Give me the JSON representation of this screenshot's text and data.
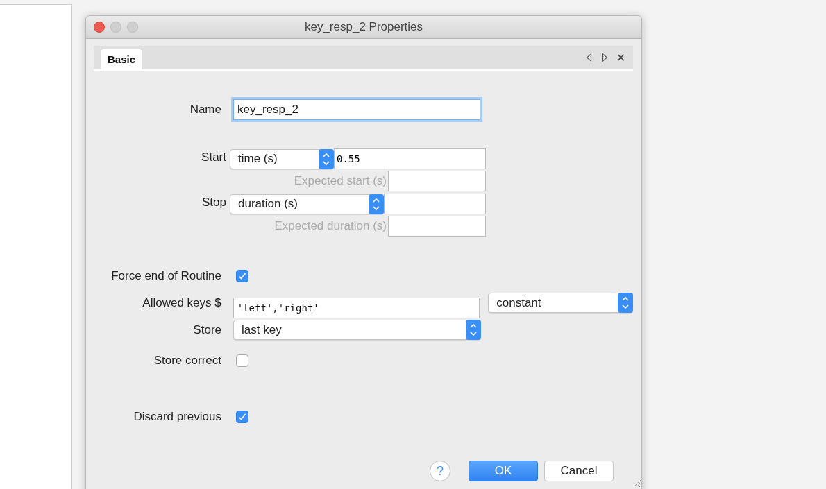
{
  "window": {
    "title": "key_resp_2 Properties"
  },
  "tabs": [
    {
      "label": "Basic",
      "selected": true
    }
  ],
  "fields": [
    {
      "kind": "text",
      "label": "Name",
      "value": "key_resp_2",
      "focused": true
    },
    {
      "kind": "timing",
      "label": "Start",
      "select": "time (s)",
      "value": "0.55",
      "expected_label": "Expected start (s)"
    },
    {
      "kind": "timing",
      "label": "Stop",
      "select": "duration (s)",
      "expected_label": "Expected duration (s)"
    },
    {
      "kind": "checkbox",
      "label": "Force end of Routine",
      "checked": true
    },
    {
      "kind": "text_select",
      "label": "Allowed keys $",
      "value": "'left','right'",
      "select": "constant"
    },
    {
      "kind": "select",
      "label": "Store",
      "select": "last key"
    },
    {
      "kind": "checkbox",
      "label": "Store correct",
      "checked": false
    },
    {
      "kind": "checkbox",
      "label": "Discard previous",
      "checked": true
    }
  ],
  "help": "?",
  "buttons": [
    {
      "label": "OK",
      "default": true
    },
    {
      "label": "Cancel",
      "default": false
    }
  ]
}
